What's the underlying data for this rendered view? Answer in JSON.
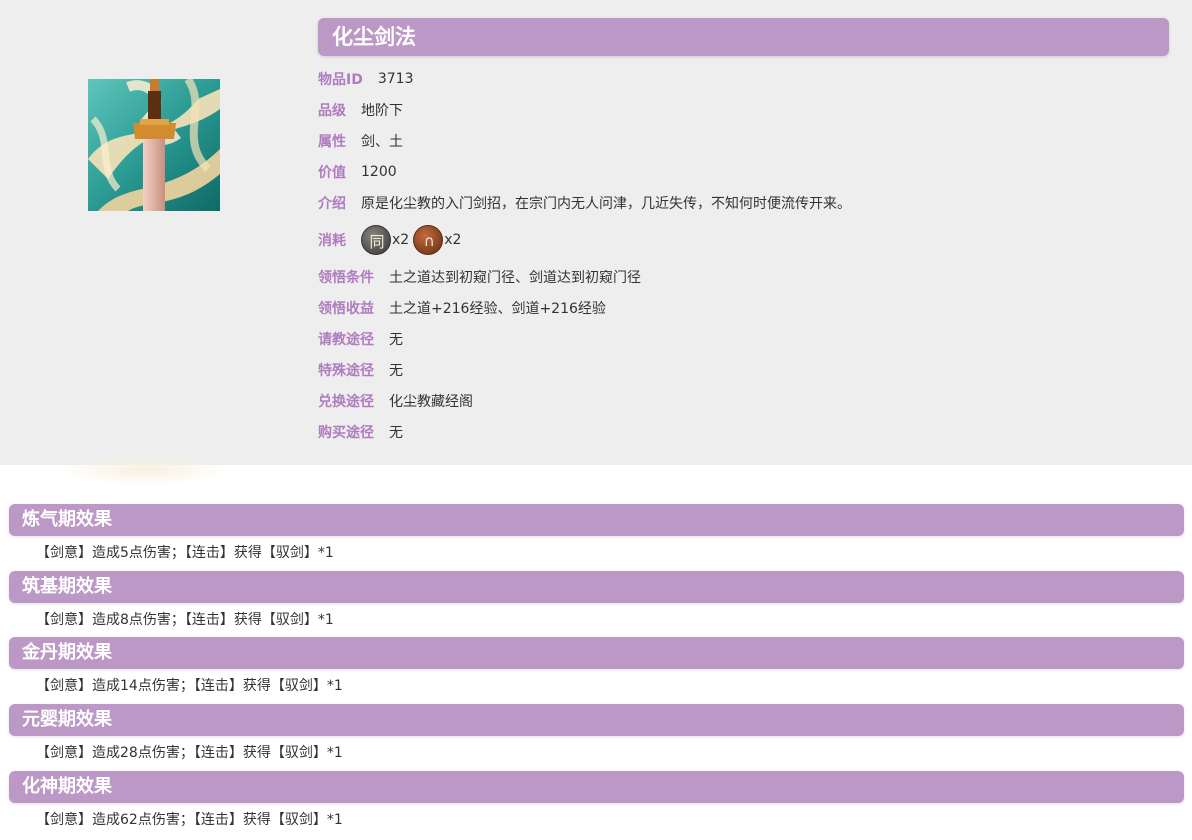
{
  "item": {
    "title": "化尘剑法",
    "icon": "sword-technique-icon",
    "fields": [
      {
        "label": "物品ID",
        "value": "3713"
      },
      {
        "label": "品级",
        "value": "地阶下"
      },
      {
        "label": "属性",
        "value": "剑、土"
      },
      {
        "label": "价值",
        "value": "1200"
      },
      {
        "label": "介绍",
        "value": "原是化尘教的入门剑招，在宗门内无人问津，几近失传，不知何时便流传开来。"
      }
    ],
    "cost": {
      "label": "消耗",
      "items": [
        {
          "icon": "grey-token-icon",
          "glyph": "同",
          "count": "x2"
        },
        {
          "icon": "brown-token-icon",
          "glyph": "∩",
          "count": "x2"
        }
      ]
    },
    "more_fields": [
      {
        "label": "领悟条件",
        "value": "土之道达到初窥门径、剑道达到初窥门径"
      },
      {
        "label": "领悟收益",
        "value": "土之道+216经验、剑道+216经验"
      },
      {
        "label": "请教途径",
        "value": "无"
      },
      {
        "label": "特殊途径",
        "value": "无"
      },
      {
        "label": "兑换途径",
        "value": "化尘教藏经阁"
      },
      {
        "label": "购买途径",
        "value": "无"
      }
    ]
  },
  "stages": [
    {
      "title": "炼气期效果",
      "effect": "【剑意】造成5点伤害；【连击】获得【驭剑】*1"
    },
    {
      "title": "筑基期效果",
      "effect": "【剑意】造成8点伤害；【连击】获得【驭剑】*1"
    },
    {
      "title": "金丹期效果",
      "effect": "【剑意】造成14点伤害；【连击】获得【驭剑】*1"
    },
    {
      "title": "元婴期效果",
      "effect": "【剑意】造成28点伤害；【连击】获得【驭剑】*1"
    },
    {
      "title": "化神期效果",
      "effect": "【剑意】造成62点伤害；【连击】获得【驭剑】*1"
    }
  ],
  "colors": {
    "accent": "#bc98c6",
    "label": "#b07cc0",
    "panel": "#eeeeee"
  }
}
